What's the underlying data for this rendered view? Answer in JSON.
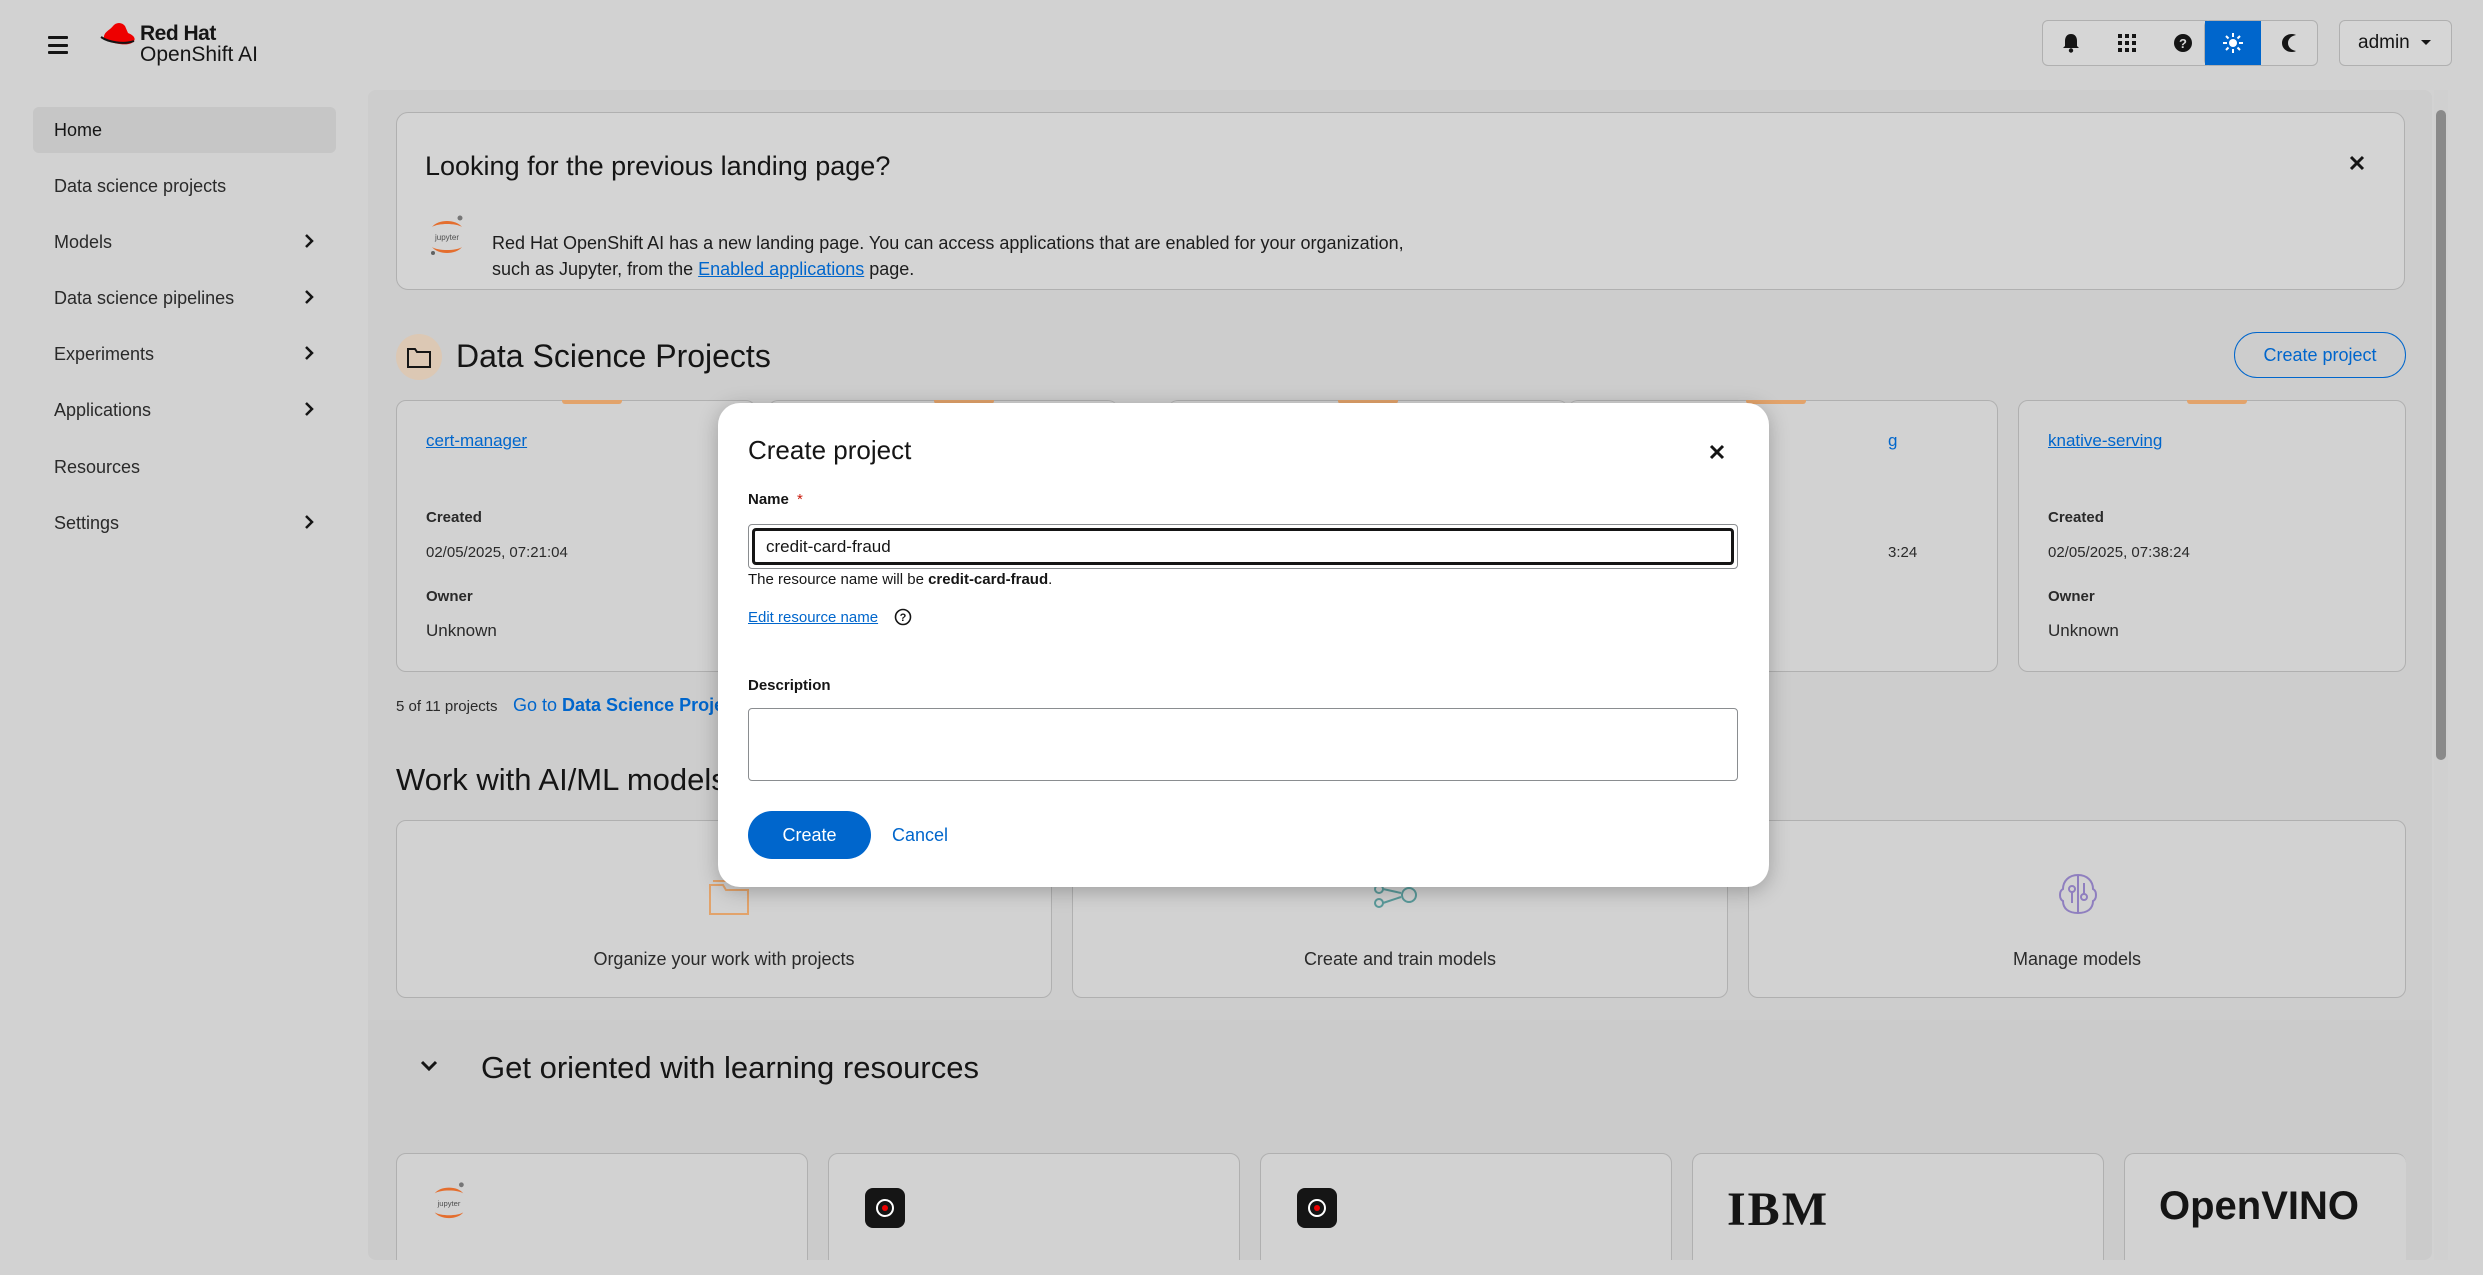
{
  "masthead": {
    "brand_line1": "Red Hat",
    "brand_line2": "OpenShift AI",
    "user": "admin",
    "icons": [
      "menu-icon",
      "bell-icon",
      "app-grid-icon",
      "help-icon",
      "sun-icon",
      "moon-icon"
    ]
  },
  "sidebar": {
    "items": [
      {
        "label": "Home",
        "expandable": false,
        "current": true
      },
      {
        "label": "Data science projects",
        "expandable": false
      },
      {
        "label": "Models",
        "expandable": true
      },
      {
        "label": "Data science pipelines",
        "expandable": true
      },
      {
        "label": "Experiments",
        "expandable": true
      },
      {
        "label": "Applications",
        "expandable": true
      },
      {
        "label": "Resources",
        "expandable": false
      },
      {
        "label": "Settings",
        "expandable": true
      }
    ]
  },
  "banner": {
    "title": "Looking for the previous landing page?",
    "text_before": "Red Hat OpenShift AI has a new landing page. You can access applications that are enabled for your organization, such as Jupyter, from the ",
    "link": "Enabled applications",
    "text_after": " page.",
    "icon_text": "jupyter"
  },
  "projects": {
    "title": "Data Science Projects",
    "create_button": "Create project",
    "cards": [
      {
        "name": "cert-manager",
        "created_label": "Created",
        "created": "02/05/2025, 07:21:04",
        "owner_label": "Owner",
        "owner": "Unknown"
      },
      {
        "name": "knative-serving",
        "created_label": "Created",
        "created": "02/05/2025, 07:38:24",
        "owner_label": "Owner",
        "owner": "Unknown"
      }
    ],
    "partial_card_name": "g",
    "partial_card_created": "3:24",
    "count_text": "5 of 11 projects",
    "goto_prefix": "Go to ",
    "goto_bold": "Data Science Projec"
  },
  "ai_ml": {
    "title": "Work with AI/ML models",
    "tiles": [
      "Organize your work with projects",
      "Create and train models",
      "Manage models"
    ]
  },
  "learning": {
    "title": "Get oriented with learning resources",
    "ibm": "IBM",
    "openvino": "OpenVINO"
  },
  "modal": {
    "title": "Create project",
    "name_label": "Name",
    "required_mark": "*",
    "name_value": "credit-card-fraud",
    "help_prefix": "The resource name will be ",
    "help_value": "credit-card-fraud",
    "help_suffix": ".",
    "edit_link": "Edit resource name",
    "description_label": "Description",
    "description_value": "",
    "create_button": "Create",
    "cancel_button": "Cancel"
  },
  "colors": {
    "accent": "#0066cc",
    "brand_red": "#ee0000",
    "project_bar": "#e2a36b"
  }
}
